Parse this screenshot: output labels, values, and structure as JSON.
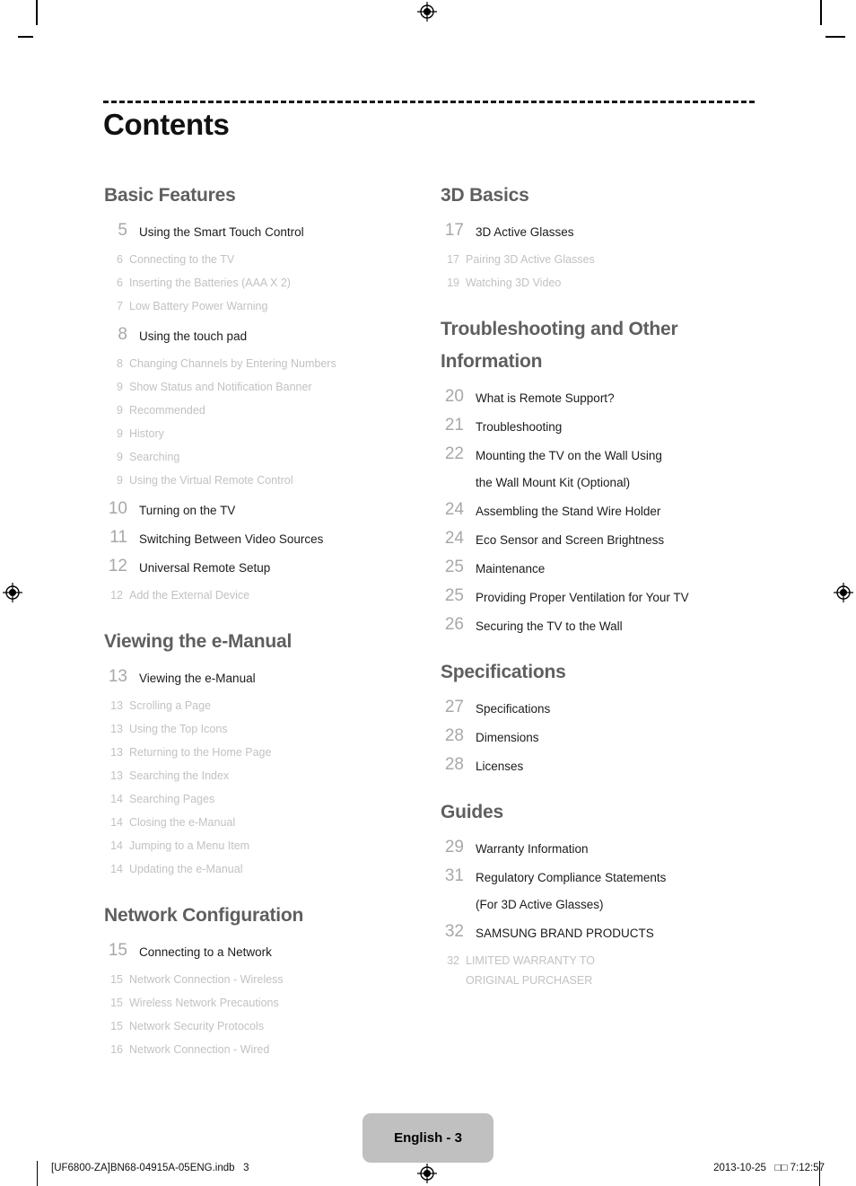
{
  "document": {
    "title": "Contents",
    "page_badge": "English - 3",
    "footer_left": "[UF6800-ZA]BN68-04915A-05ENG.indb   3",
    "footer_right": "2013-10-25   □□ 7:12:57"
  },
  "columns": {
    "left": [
      {
        "heading": "Basic Features",
        "entries": [
          {
            "num": "5",
            "label": "Using the Smart Touch Control",
            "subs": [
              {
                "num": "6",
                "label": "Connecting to the TV"
              },
              {
                "num": "6",
                "label": "Inserting the Batteries (AAA X 2)"
              },
              {
                "num": "7",
                "label": "Low Battery Power Warning"
              }
            ]
          },
          {
            "num": "8",
            "label": "Using the touch pad",
            "subs": [
              {
                "num": "8",
                "label": "Changing Channels by Entering Numbers"
              },
              {
                "num": "9",
                "label": "Show Status and Notification Banner"
              },
              {
                "num": "9",
                "label": "Recommended"
              },
              {
                "num": "9",
                "label": "History"
              },
              {
                "num": "9",
                "label": "Searching"
              },
              {
                "num": "9",
                "label": "Using the Virtual Remote Control"
              }
            ]
          },
          {
            "num": "10",
            "label": "Turning on the TV",
            "subs": []
          },
          {
            "num": "11",
            "label": "Switching Between Video Sources",
            "subs": []
          },
          {
            "num": "12",
            "label": "Universal Remote Setup",
            "subs": [
              {
                "num": "12",
                "label": "Add the External Device"
              }
            ]
          }
        ]
      },
      {
        "heading": "Viewing the e-Manual",
        "entries": [
          {
            "num": "13",
            "label": "Viewing the e-Manual",
            "subs": [
              {
                "num": "13",
                "label": "Scrolling a Page"
              },
              {
                "num": "13",
                "label": "Using the Top Icons"
              },
              {
                "num": "13",
                "label": "Returning to the Home Page"
              },
              {
                "num": "13",
                "label": "Searching the Index"
              },
              {
                "num": "14",
                "label": "Searching Pages"
              },
              {
                "num": "14",
                "label": "Closing the e-Manual"
              },
              {
                "num": "14",
                "label": "Jumping to a Menu Item"
              },
              {
                "num": "14",
                "label": "Updating the e-Manual"
              }
            ]
          }
        ]
      },
      {
        "heading": "Network Configuration",
        "entries": [
          {
            "num": "15",
            "label": "Connecting to a Network",
            "subs": [
              {
                "num": "15",
                "label": "Network Connection - Wireless"
              },
              {
                "num": "15",
                "label": "Wireless Network Precautions"
              },
              {
                "num": "15",
                "label": "Network Security Protocols"
              },
              {
                "num": "16",
                "label": "Network Connection - Wired"
              }
            ]
          }
        ]
      }
    ],
    "right": [
      {
        "heading": "3D Basics",
        "entries": [
          {
            "num": "17",
            "label": "3D Active Glasses",
            "subs": [
              {
                "num": "17",
                "label": "Pairing 3D Active Glasses"
              },
              {
                "num": "19",
                "label": "Watching 3D Video"
              }
            ]
          }
        ]
      },
      {
        "heading": "Troubleshooting and Other Information",
        "entries": [
          {
            "num": "20",
            "label": "What is Remote Support?",
            "subs": []
          },
          {
            "num": "21",
            "label": "Troubleshooting",
            "subs": []
          },
          {
            "num": "22",
            "label": "Mounting the TV on the Wall Using",
            "label_cont": "the Wall Mount Kit (Optional)",
            "subs": []
          },
          {
            "num": "24",
            "label": "Assembling the Stand Wire Holder",
            "subs": []
          },
          {
            "num": "24",
            "label": "Eco Sensor and Screen Brightness",
            "subs": []
          },
          {
            "num": "25",
            "label": "Maintenance",
            "subs": []
          },
          {
            "num": "25",
            "label": "Providing Proper Ventilation for Your TV",
            "subs": []
          },
          {
            "num": "26",
            "label": "Securing the TV to the Wall",
            "subs": []
          }
        ]
      },
      {
        "heading": "Specifications",
        "entries": [
          {
            "num": "27",
            "label": "Specifications",
            "subs": []
          },
          {
            "num": "28",
            "label": "Dimensions",
            "subs": []
          },
          {
            "num": "28",
            "label": "Licenses",
            "subs": []
          }
        ]
      },
      {
        "heading": "Guides",
        "entries": [
          {
            "num": "29",
            "label": "Warranty Information",
            "subs": []
          },
          {
            "num": "31",
            "label": "Regulatory Compliance Statements",
            "label_cont": "(For 3D Active Glasses)",
            "subs": []
          },
          {
            "num": "32",
            "label": "SAMSUNG BRAND PRODUCTS",
            "subs": [
              {
                "num": "32",
                "label": "LIMITED WARRANTY TO",
                "label_cont": "ORIGINAL PURCHASER"
              }
            ]
          }
        ]
      }
    ]
  },
  "colors": {
    "heading": "#5f5f5f",
    "entry_number": "#a8a8a8",
    "entry_label": "#1b1b1b",
    "sub_text": "#c2c2c2",
    "badge_bg": "#c0c0c0"
  }
}
